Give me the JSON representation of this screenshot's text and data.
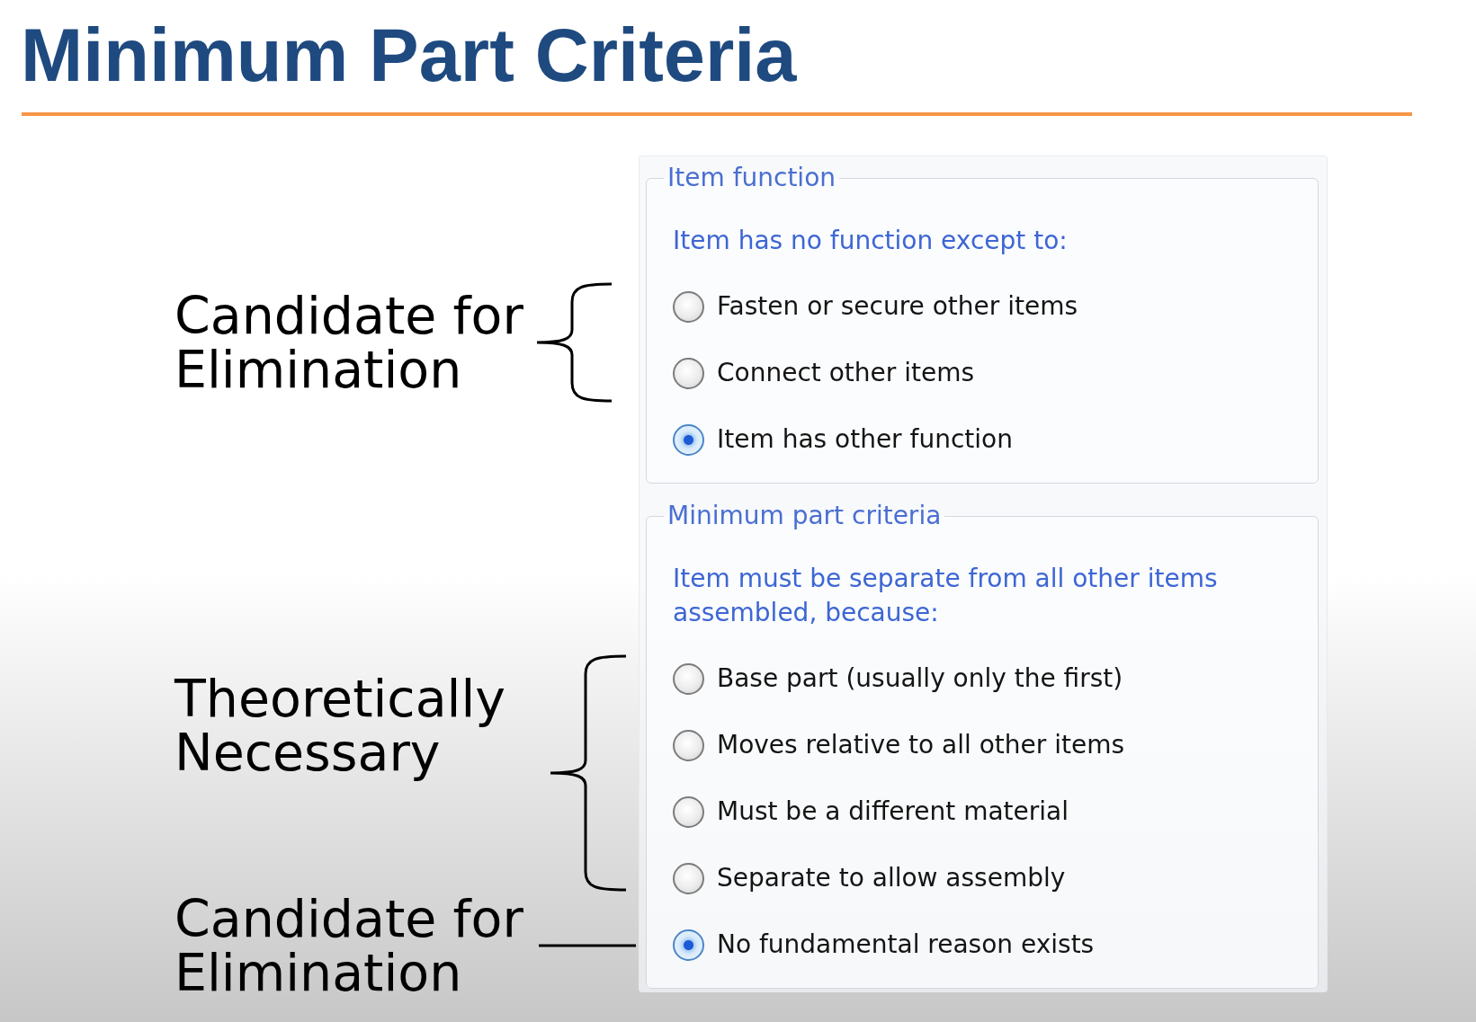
{
  "title": "Minimum Part Criteria",
  "annotations": [
    {
      "kind": "brace",
      "label": "Candidate for Elimination"
    },
    {
      "kind": "brace",
      "label": "Theoretically Necessary"
    },
    {
      "kind": "line",
      "label": "Candidate for Elimination"
    }
  ],
  "groups": [
    {
      "legend": "Item function",
      "prompt": "Item has no function except to:",
      "options": [
        {
          "label": "Fasten or secure other items",
          "selected": false
        },
        {
          "label": "Connect other items",
          "selected": false
        },
        {
          "label": "Item has other function",
          "selected": true
        }
      ]
    },
    {
      "legend": "Minimum part criteria",
      "prompt": "Item must be separate from all other items assembled, because:",
      "options": [
        {
          "label": "Base part (usually only the first)",
          "selected": false
        },
        {
          "label": "Moves relative to all other items",
          "selected": false
        },
        {
          "label": "Must be a different material",
          "selected": false
        },
        {
          "label": "Separate to allow assembly",
          "selected": false
        },
        {
          "label": "No fundamental reason exists",
          "selected": true
        }
      ]
    }
  ]
}
